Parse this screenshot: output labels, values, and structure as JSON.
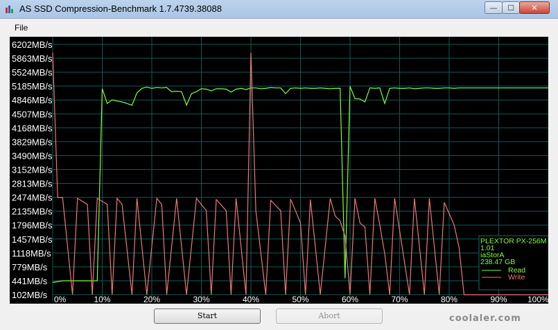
{
  "window": {
    "title": "AS SSD Compression-Benchmark 1.7.4739.38088",
    "min_glyph": "—",
    "max_glyph": "☐",
    "close_glyph": "✕"
  },
  "menu": {
    "file": "File"
  },
  "buttons": {
    "start": "Start",
    "abort": "Abort"
  },
  "watermark": "coolaler.com",
  "chart_data": {
    "type": "line",
    "background": "#000000",
    "grid": true,
    "grid_color": "#0f5a5a",
    "y_tick_labels": [
      "6202MB/s",
      "5863MB/s",
      "5524MB/s",
      "5185MB/s",
      "4846MB/s",
      "4507MB/s",
      "4168MB/s",
      "3829MB/s",
      "3490MB/s",
      "3152MB/s",
      "2813MB/s",
      "2474MB/s",
      "2135MB/s",
      "1796MB/s",
      "1457MB/s",
      "1118MB/s",
      "779MB/s",
      "441MB/s",
      "102MB/s"
    ],
    "x_tick_labels": [
      "0%",
      "10%",
      "20%",
      "30%",
      "40%",
      "50%",
      "60%",
      "70%",
      "80%",
      "90%",
      "100%"
    ],
    "ylim": [
      102,
      6202
    ],
    "xlim": [
      0,
      100
    ],
    "legend": {
      "position": "bottom-right",
      "lines": [
        "PLEXTOR PX-256M",
        "1.01",
        "iaStorA",
        "238.47 GB"
      ]
    },
    "series": [
      {
        "name": "Read",
        "color": "#80ff40",
        "points": [
          [
            0,
            400
          ],
          [
            2,
            440
          ],
          [
            9,
            440
          ],
          [
            10,
            5120
          ],
          [
            11,
            4760
          ],
          [
            12,
            4850
          ],
          [
            13,
            4820
          ],
          [
            14,
            4800
          ],
          [
            15,
            4760
          ],
          [
            16,
            4720
          ],
          [
            17,
            5020
          ],
          [
            18,
            5130
          ],
          [
            19,
            5160
          ],
          [
            20,
            5130
          ],
          [
            21,
            5150
          ],
          [
            22,
            5140
          ],
          [
            23,
            5150
          ],
          [
            24,
            5050
          ],
          [
            25,
            5060
          ],
          [
            26,
            5050
          ],
          [
            27,
            4720
          ],
          [
            28,
            5000
          ],
          [
            29,
            5050
          ],
          [
            30,
            5120
          ],
          [
            31,
            5110
          ],
          [
            32,
            5070
          ],
          [
            33,
            5120
          ],
          [
            34,
            5120
          ],
          [
            35,
            5110
          ],
          [
            36,
            5040
          ],
          [
            37,
            5110
          ],
          [
            38,
            5130
          ],
          [
            39,
            5100
          ],
          [
            40,
            5140
          ],
          [
            41,
            5140
          ],
          [
            42,
            5120
          ],
          [
            43,
            5130
          ],
          [
            44,
            5150
          ],
          [
            45,
            5140
          ],
          [
            46,
            5140
          ],
          [
            47,
            5000
          ],
          [
            48,
            5130
          ],
          [
            49,
            5140
          ],
          [
            50,
            5130
          ],
          [
            51,
            5140
          ],
          [
            52,
            5130
          ],
          [
            53,
            5130
          ],
          [
            54,
            5140
          ],
          [
            55,
            5130
          ],
          [
            56,
            5120
          ],
          [
            57,
            5130
          ],
          [
            58,
            5130
          ],
          [
            59,
            500
          ],
          [
            60,
            5180
          ],
          [
            61,
            4880
          ],
          [
            62,
            4870
          ],
          [
            63,
            4800
          ],
          [
            64,
            5140
          ],
          [
            65,
            5130
          ],
          [
            66,
            5140
          ],
          [
            67,
            4760
          ],
          [
            68,
            5130
          ],
          [
            69,
            5140
          ],
          [
            70,
            5130
          ],
          [
            71,
            5130
          ],
          [
            72,
            5140
          ],
          [
            73,
            5120
          ],
          [
            74,
            5130
          ],
          [
            75,
            5140
          ],
          [
            76,
            5140
          ],
          [
            77,
            5130
          ],
          [
            78,
            5130
          ],
          [
            79,
            5140
          ],
          [
            80,
            5140
          ],
          [
            81,
            5130
          ],
          [
            82,
            5140
          ],
          [
            100,
            5140
          ]
        ]
      },
      {
        "name": "Write",
        "color": "#f07878",
        "points": [
          [
            0,
            6000
          ],
          [
            1,
            2470
          ],
          [
            2,
            2470
          ],
          [
            4,
            100
          ],
          [
            5,
            2450
          ],
          [
            7,
            2300
          ],
          [
            8,
            100
          ],
          [
            9,
            2450
          ],
          [
            11,
            2300
          ],
          [
            12,
            100
          ],
          [
            13,
            2450
          ],
          [
            14,
            2300
          ],
          [
            16,
            100
          ],
          [
            17,
            2450
          ],
          [
            19,
            100
          ],
          [
            21,
            2450
          ],
          [
            22,
            2300
          ],
          [
            23,
            100
          ],
          [
            25,
            2450
          ],
          [
            27,
            100
          ],
          [
            29,
            2450
          ],
          [
            31,
            2150
          ],
          [
            32,
            100
          ],
          [
            33,
            2420
          ],
          [
            35,
            2150
          ],
          [
            36,
            100
          ],
          [
            37,
            2450
          ],
          [
            39,
            100
          ],
          [
            40,
            6000
          ],
          [
            41,
            2150
          ],
          [
            43,
            100
          ],
          [
            44,
            2400
          ],
          [
            46,
            2150
          ],
          [
            47,
            100
          ],
          [
            48,
            2430
          ],
          [
            49,
            2150
          ],
          [
            50,
            1850
          ],
          [
            51,
            100
          ],
          [
            52,
            2420
          ],
          [
            54,
            100
          ],
          [
            56,
            2450
          ],
          [
            57,
            2020
          ],
          [
            58,
            1900
          ],
          [
            59,
            1520
          ],
          [
            60,
            100
          ],
          [
            61,
            2450
          ],
          [
            62,
            1850
          ],
          [
            63,
            1750
          ],
          [
            64,
            100
          ],
          [
            65,
            2450
          ],
          [
            66,
            1800
          ],
          [
            67,
            1100
          ],
          [
            68,
            100
          ],
          [
            69,
            2450
          ],
          [
            72,
            100
          ],
          [
            73,
            2450
          ],
          [
            75,
            100
          ],
          [
            76,
            2450
          ],
          [
            78,
            100
          ],
          [
            79,
            2350
          ],
          [
            81,
            1800
          ],
          [
            82,
            1250
          ],
          [
            83,
            100
          ],
          [
            100,
            100
          ]
        ]
      }
    ]
  }
}
